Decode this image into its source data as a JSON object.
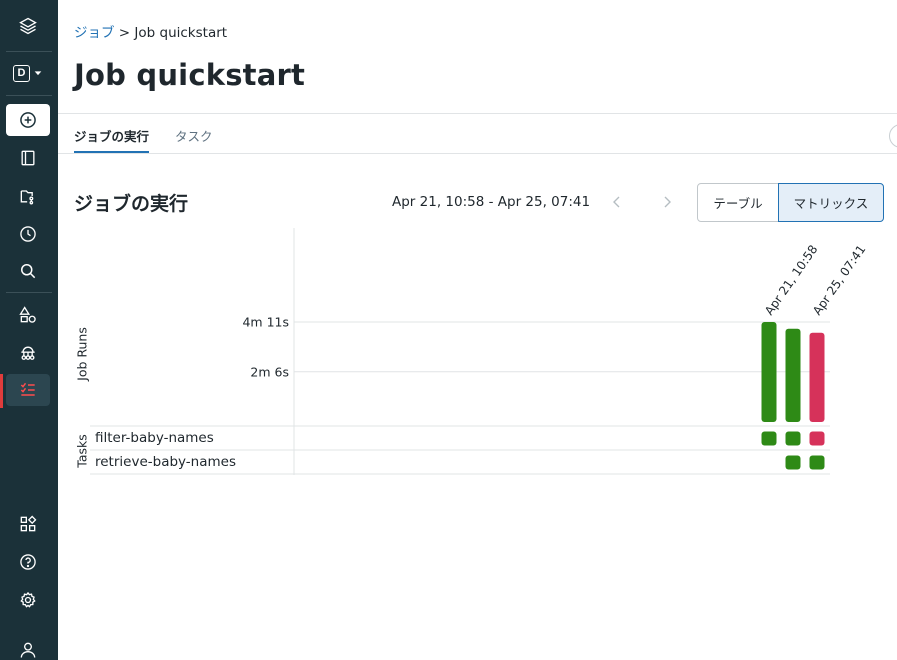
{
  "breadcrumb": {
    "parent": "ジョブ",
    "separator": ">",
    "current": "Job quickstart"
  },
  "page": {
    "title": "Job quickstart"
  },
  "tabs": [
    {
      "label": "ジョブの実行",
      "active": true
    },
    {
      "label": "タスク",
      "active": false
    }
  ],
  "section": {
    "title": "ジョブの実行",
    "date_range": "Apr 21, 10:58 - Apr 25, 07:41",
    "view_toggle": {
      "table_label": "テーブル",
      "matrix_label": "マトリックス",
      "selected": "matrix"
    }
  },
  "sidebar": {
    "workspace_letter": "D",
    "icons": [
      "databricks-logo-icon",
      "workspace-switcher-icon",
      "new-icon",
      "workspace-icon",
      "repos-icon",
      "recents-icon",
      "search-icon",
      "data-icon",
      "compute-icon",
      "workflows-icon",
      "marketplace-icon",
      "help-icon",
      "settings-icon",
      "user-icon"
    ]
  },
  "colors": {
    "success": "#2e8a16",
    "failed": "#d6325a",
    "accent": "#2272b4",
    "sidebar_bg": "#1b3139"
  },
  "chart_data": {
    "type": "bar",
    "y_axis_label": "Job Runs",
    "tasks_axis_label": "Tasks",
    "y_ticks": [
      {
        "value": 126,
        "label": "2m 6s"
      },
      {
        "value": 251,
        "label": "4m 11s"
      }
    ],
    "ylim": [
      0,
      251
    ],
    "runs": [
      {
        "start_label": "Apr 21, 10:58",
        "duration": 251,
        "status": "success"
      },
      {
        "start_label": "",
        "duration": 234,
        "status": "success"
      },
      {
        "start_label": "Apr 25, 07:41",
        "duration": 224,
        "status": "failed"
      }
    ],
    "tasks": [
      {
        "name": "filter-baby-names",
        "statuses": [
          "success",
          "success",
          "failed"
        ]
      },
      {
        "name": "retrieve-baby-names",
        "statuses": [
          null,
          "success",
          "success"
        ]
      }
    ]
  }
}
